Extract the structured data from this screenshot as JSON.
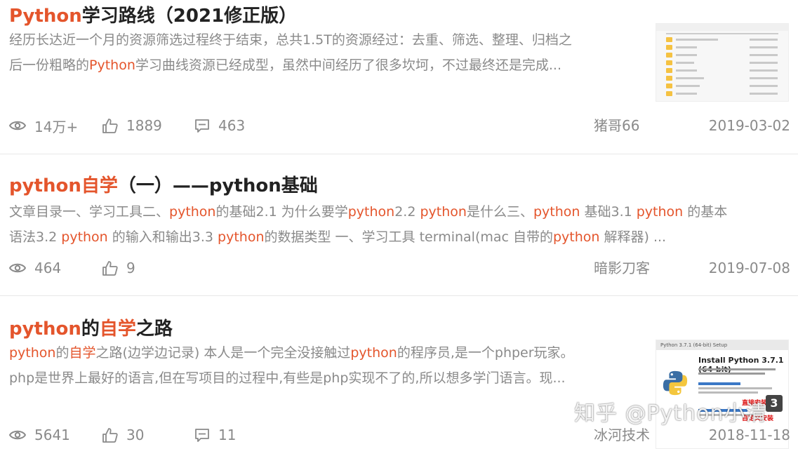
{
  "results": [
    {
      "title_parts": [
        "Python",
        "学习路线（2021修正版）"
      ],
      "desc_line1": [
        "经历长达近一个月的资源筛选过程终于结束，总共1.5T的资源经过：去重、筛选、整理、归档之"
      ],
      "desc_line2": [
        "后一份粗略的",
        "Python",
        "学习曲线资源已经成型，虽然中间经历了很多坎坷，不过最终还是完成..."
      ],
      "views": "14万+",
      "likes": "1889",
      "comments": "463",
      "author": "猪哥66",
      "date": "2019-03-02"
    },
    {
      "title_parts": [
        "python自学",
        "（一）——python基础"
      ],
      "desc_line1": [
        "文章目录一、学习工具二、",
        "python",
        "的基础2.1 为什么要学",
        "python",
        "2.2 ",
        "python",
        "是什么三、",
        "python",
        " 基础3.1 ",
        "python",
        " 的基本"
      ],
      "desc_line2": [
        "语法3.2 ",
        "python",
        " 的输入和输出3.3 ",
        "python",
        "的数据类型 一、学习工具 terminal(mac 自带的",
        "python",
        " 解释器) ..."
      ],
      "views": "464",
      "likes": "9",
      "author": "暗影刀客",
      "date": "2019-07-08"
    },
    {
      "title_parts": [
        "python",
        "的",
        "自学",
        "之路"
      ],
      "desc_line1": [
        "python",
        "的",
        "自学",
        "之路(边学边记录) 本人是一个完全没接触过",
        "python",
        "的程序员,是一个phper玩家。"
      ],
      "desc_line2": [
        "php是世界上最好的语言,但在写项目的过程中,有些是php实现不了的,所以想多学门语言。现..."
      ],
      "views": "5641",
      "likes": "30",
      "comments": "11",
      "author": "冰河技术",
      "date": "2018-11-18"
    }
  ],
  "thumb3": {
    "window_title": "Python 3.7.1 (64-bit) Setup",
    "heading": "Install Python 3.7.1 (64-bit)",
    "note1": "直接安装",
    "note2": "自定义安装"
  },
  "watermark": "知乎 @Python小清",
  "icons": [
    "eye-icon",
    "thumbs-up-icon",
    "comment-icon",
    "folder-icon",
    "python-logo-icon"
  ],
  "colors": {
    "highlight": "#e4552c",
    "meta": "#8a8a8a",
    "title": "#222222"
  }
}
